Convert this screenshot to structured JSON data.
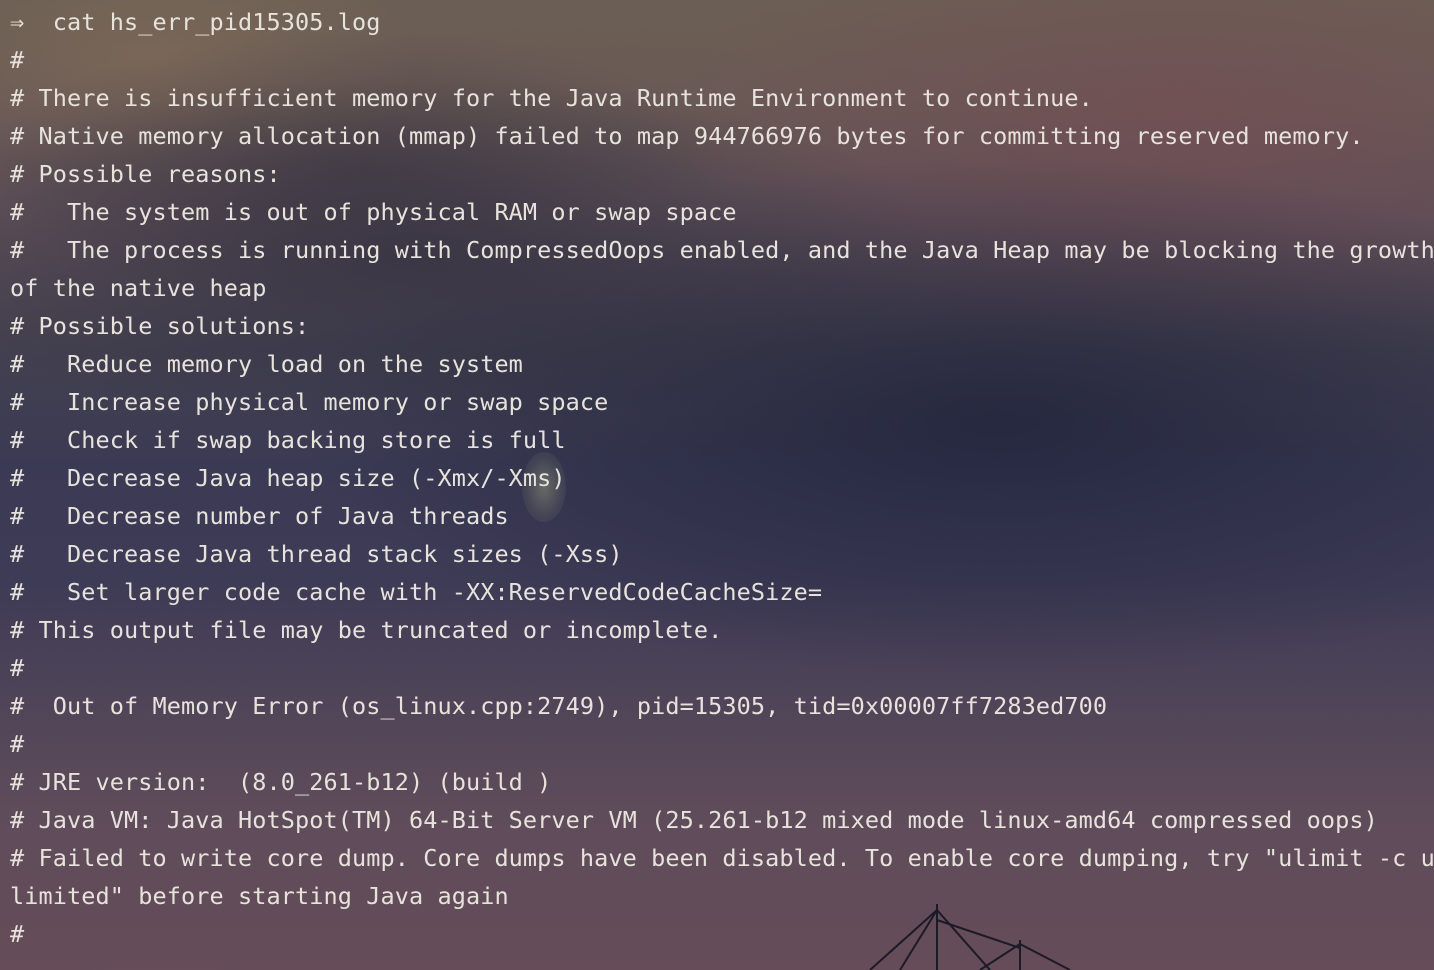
{
  "terminal": {
    "prompt_symbol": "⇒",
    "command": "cat hs_err_pid15305.log",
    "lines": [
      "#",
      "# There is insufficient memory for the Java Runtime Environment to continue.",
      "# Native memory allocation (mmap) failed to map 944766976 bytes for committing reserved memory.",
      "# Possible reasons:",
      "#   The system is out of physical RAM or swap space",
      "#   The process is running with CompressedOops enabled, and the Java Heap may be blocking the growth",
      "of the native heap",
      "# Possible solutions:",
      "#   Reduce memory load on the system",
      "#   Increase physical memory or swap space",
      "#   Check if swap backing store is full",
      "#   Decrease Java heap size (-Xmx/-Xms)",
      "#   Decrease number of Java threads",
      "#   Decrease Java thread stack sizes (-Xss)",
      "#   Set larger code cache with -XX:ReservedCodeCacheSize=",
      "# This output file may be truncated or incomplete.",
      "#",
      "#  Out of Memory Error (os_linux.cpp:2749), pid=15305, tid=0x00007ff7283ed700",
      "#",
      "# JRE version:  (8.0_261-b12) (build )",
      "# Java VM: Java HotSpot(TM) 64-Bit Server VM (25.261-b12 mixed mode linux-amd64 compressed oops)",
      "# Failed to write core dump. Core dumps have been disabled. To enable core dumping, try \"ulimit -c un",
      "limited\" before starting Java again",
      "#"
    ]
  },
  "colors": {
    "text": "#e7e3dc"
  }
}
